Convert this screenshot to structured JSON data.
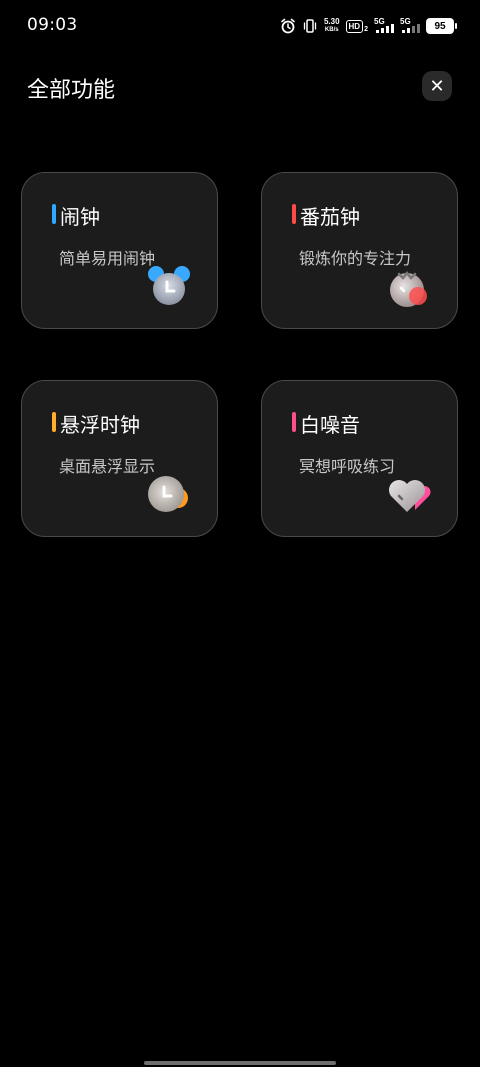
{
  "status_bar": {
    "time": "09:03",
    "net_speed_value": "5.30",
    "net_speed_unit": "KB/s",
    "hd_label": "HD",
    "hd_sub": "2",
    "sim1_label": "5G",
    "sim2_label": "5G",
    "battery": "95"
  },
  "header": {
    "title": "全部功能",
    "close_label": "✕"
  },
  "features": [
    {
      "title": "闹钟",
      "description": "简单易用闹钟",
      "accent": "#2fa8ff",
      "icon": "alarm-clock-icon"
    },
    {
      "title": "番茄钟",
      "description": "锻炼你的专注力",
      "accent": "#ff4a4a",
      "icon": "tomato-icon"
    },
    {
      "title": "悬浮时钟",
      "description": "桌面悬浮显示",
      "accent": "#ffae2a",
      "icon": "floating-clock-icon"
    },
    {
      "title": "白噪音",
      "description": "冥想呼吸练习",
      "accent": "#ff4f8a",
      "icon": "heart-icon"
    }
  ]
}
